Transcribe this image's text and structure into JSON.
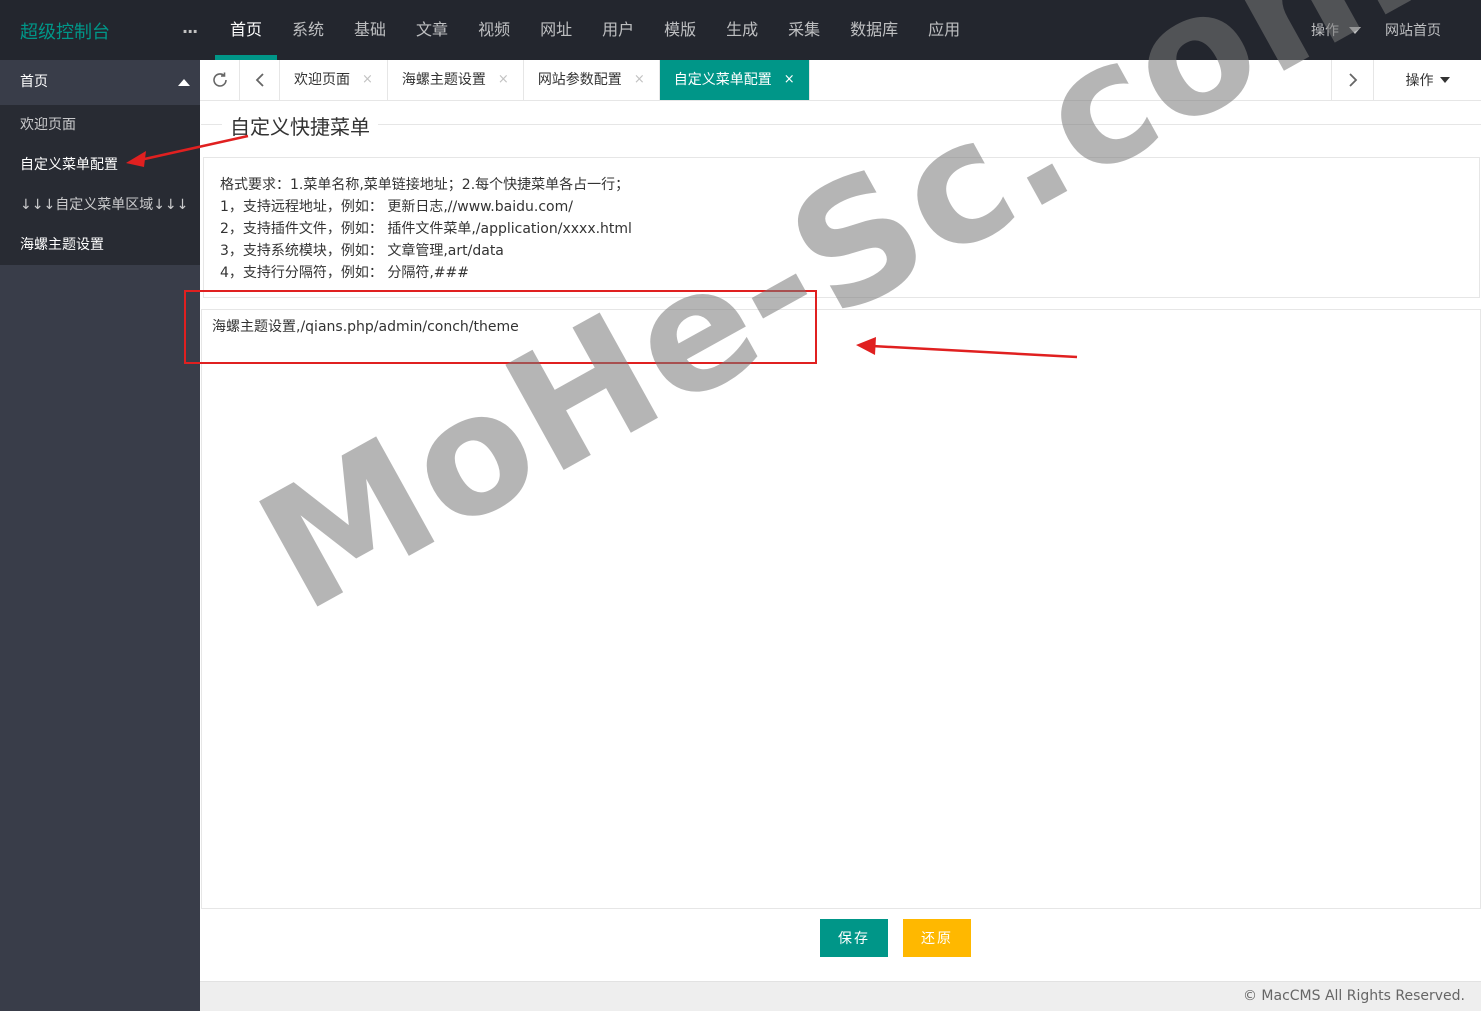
{
  "app": {
    "title": "超级控制台",
    "more": "..."
  },
  "nav": {
    "items": [
      "首页",
      "系统",
      "基础",
      "文章",
      "视频",
      "网址",
      "用户",
      "模版",
      "生成",
      "采集",
      "数据库",
      "应用"
    ],
    "active_index": 0
  },
  "top_right": {
    "operations_label": "操作",
    "home_label": "网站首页"
  },
  "sidebar": {
    "header": "首页",
    "items": [
      {
        "label": "欢迎页面"
      },
      {
        "label": "自定义菜单配置"
      },
      {
        "label": "↓↓↓自定义菜单区域↓↓↓"
      },
      {
        "label": "海螺主题设置"
      }
    ]
  },
  "tabs": {
    "items": [
      {
        "label": "欢迎页面"
      },
      {
        "label": "海螺主题设置"
      },
      {
        "label": "网站参数配置"
      },
      {
        "label": "自定义菜单配置"
      }
    ],
    "active_index": 3,
    "close_glyph": "×",
    "operations_label": "操作"
  },
  "form": {
    "legend": "自定义快捷菜单",
    "tips": [
      "格式要求：1.菜单名称,菜单链接地址；2.每个快捷菜单各占一行；",
      "1，支持远程地址，例如： 更新日志,//www.baidu.com/",
      "2，支持插件文件，例如： 插件文件菜单,/application/xxxx.html",
      "3，支持系统模块，例如： 文章管理,art/data",
      "4，支持行分隔符，例如： 分隔符,###"
    ],
    "textarea_value": "海螺主题设置,/qians.php/admin/conch/theme",
    "save_label": "保存",
    "reset_label": "还原"
  },
  "footer": {
    "text": "© MacCMS All Rights Reserved."
  },
  "watermark": {
    "text": "MoHe-Sc.com"
  },
  "colors": {
    "accent": "#009688",
    "warning": "#ffb800",
    "topbar": "#23262e",
    "sidebar": "#393d49",
    "annotation": "#e02020"
  }
}
